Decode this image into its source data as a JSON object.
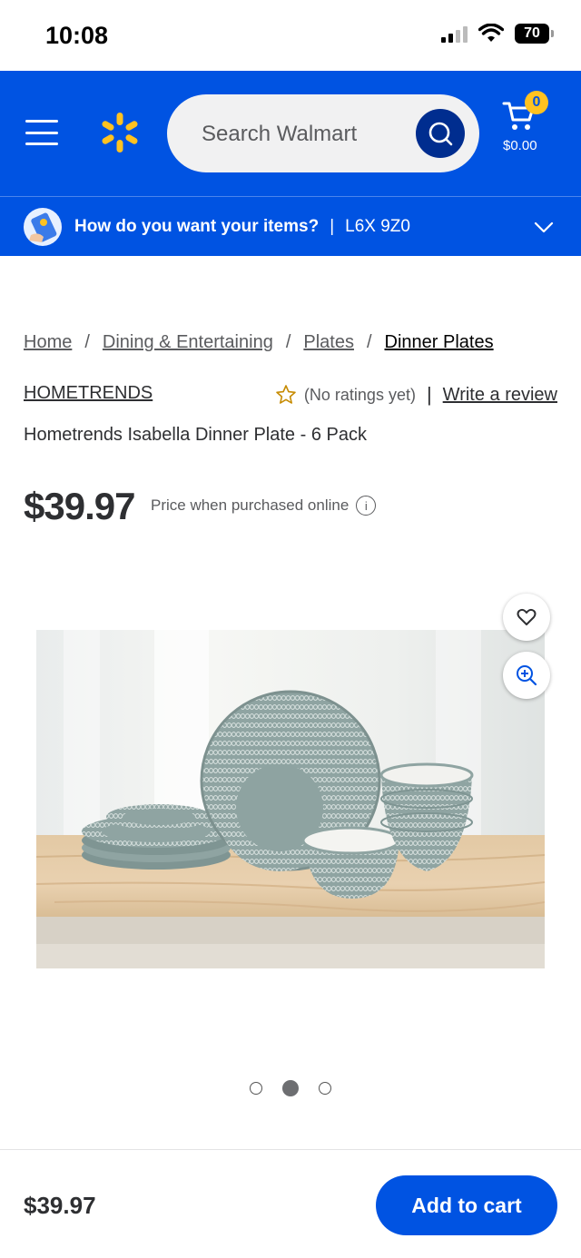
{
  "status_bar": {
    "time": "10:08",
    "battery": "70"
  },
  "header": {
    "search": {
      "placeholder": "Search Walmart"
    },
    "cart": {
      "count": "0",
      "total": "$0.00"
    }
  },
  "location_bar": {
    "question": "How do you want your items?",
    "separator": "|",
    "postal_code": "L6X 9Z0"
  },
  "breadcrumb": {
    "items": [
      "Home",
      "Dining & Entertaining",
      "Plates",
      "Dinner Plates"
    ],
    "separator": "/"
  },
  "product": {
    "brand": "HOMETRENDS",
    "rating_text": "(No ratings yet)",
    "rating_separator": "|",
    "write_review": "Write a review",
    "title": "Hometrends Isabella Dinner Plate - 6 Pack",
    "price": "$39.97",
    "price_note": "Price when purchased online",
    "info_glyph": "i"
  },
  "carousel": {
    "image_count": 3,
    "active_index": 1
  },
  "bottom_bar": {
    "price": "$39.97",
    "add_label": "Add to cart"
  },
  "colors": {
    "brand_blue": "#0053e2",
    "spark_yellow": "#ffc220",
    "dark_blue": "#002d8f"
  },
  "icons": [
    "menu-icon",
    "spark-logo-icon",
    "search-icon",
    "cart-icon",
    "location-icon",
    "chevron-down-icon",
    "star-outline-icon",
    "info-icon",
    "heart-icon",
    "zoom-in-icon"
  ]
}
